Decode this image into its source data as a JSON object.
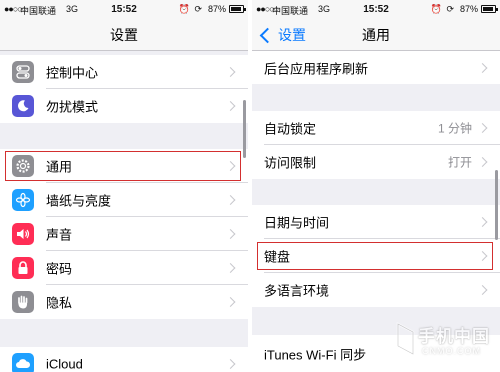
{
  "status_bar": {
    "signal": "●●○○○",
    "carrier": "中国联通",
    "network": "3G",
    "time": "15:52",
    "alarm_icon": "alarm-icon",
    "rotation_icon": "rotation-lock-icon",
    "battery_percent": "87%",
    "battery_level": 0.87
  },
  "left": {
    "title": "设置",
    "items": [
      {
        "label": "控制中心",
        "icon": "control-center-icon",
        "color": "#8e8e93"
      },
      {
        "label": "勿扰模式",
        "icon": "moon-icon",
        "color": "#5856d6"
      },
      {
        "label": "通用",
        "icon": "gear-icon",
        "color": "#8e8e93"
      },
      {
        "label": "墙纸与亮度",
        "icon": "flower-icon",
        "color": "#1ea0ff"
      },
      {
        "label": "声音",
        "icon": "speaker-icon",
        "color": "#ff2d55"
      },
      {
        "label": "密码",
        "icon": "lock-icon",
        "color": "#ff2d55"
      },
      {
        "label": "隐私",
        "icon": "hand-icon",
        "color": "#8e8e93"
      },
      {
        "label": "iCloud",
        "icon": "icloud-icon",
        "color": "#1ea0ff"
      }
    ]
  },
  "right": {
    "back_label": "设置",
    "title": "通用",
    "items": [
      {
        "label": "后台应用程序刷新",
        "value": ""
      },
      {
        "label": "自动锁定",
        "value": "1 分钟"
      },
      {
        "label": "访问限制",
        "value": "打开"
      },
      {
        "label": "日期与时间",
        "value": ""
      },
      {
        "label": "键盘",
        "value": ""
      },
      {
        "label": "多语言环境",
        "value": ""
      },
      {
        "label": "iTunes Wi-Fi 同步",
        "value": ""
      }
    ]
  },
  "watermark": {
    "text": "手机中国",
    "sub": "CNMO.COM"
  },
  "colors": {
    "highlight": "#d32f2f",
    "ios_blue": "#0a7aff",
    "group_bg": "#efeff4"
  }
}
